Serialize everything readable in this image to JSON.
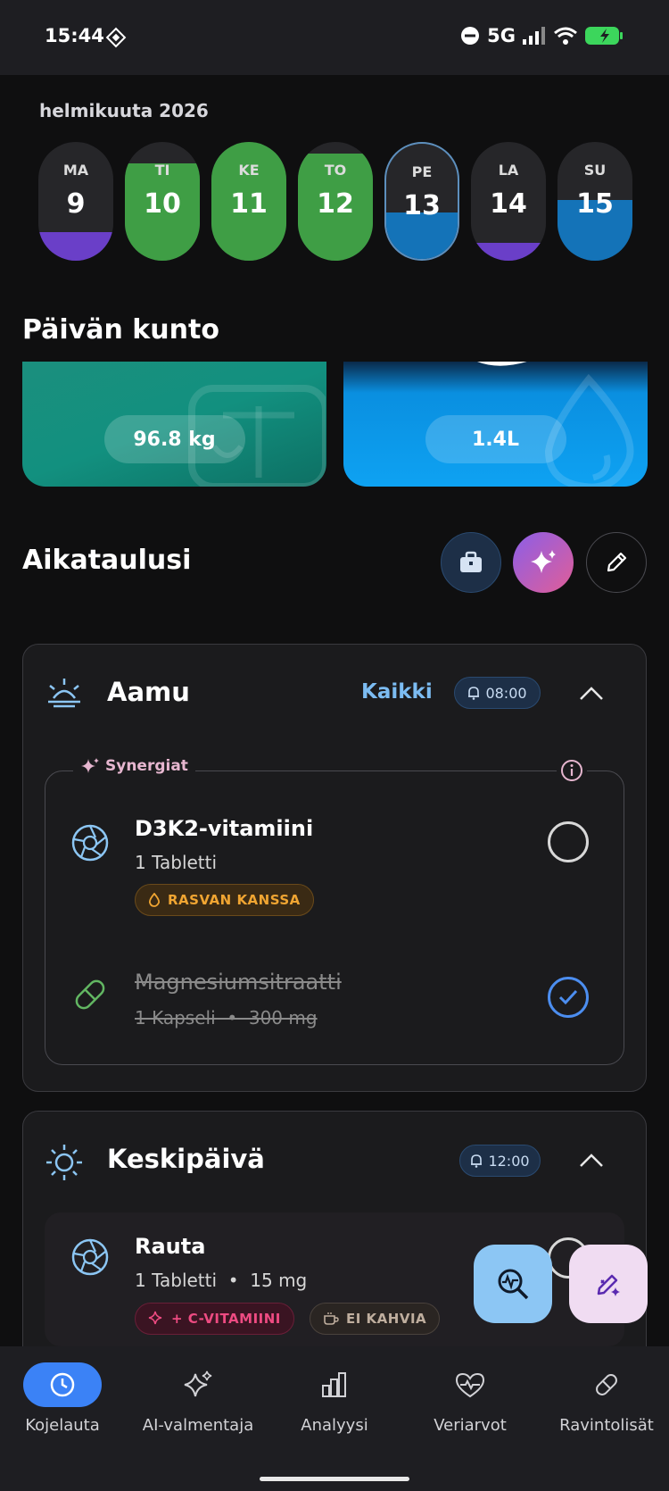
{
  "status": {
    "time": "15:44",
    "network": "5G"
  },
  "calendar": {
    "month": "helmikuuta 2026",
    "days": [
      {
        "name": "MA",
        "num": "9"
      },
      {
        "name": "TI",
        "num": "10"
      },
      {
        "name": "KE",
        "num": "11"
      },
      {
        "name": "TO",
        "num": "12"
      },
      {
        "name": "PE",
        "num": "13"
      },
      {
        "name": "LA",
        "num": "14"
      },
      {
        "name": "SU",
        "num": "15"
      }
    ]
  },
  "condition": {
    "title": "Päivän kunto",
    "weight": "96.8 kg",
    "water": "1.4L"
  },
  "schedule": {
    "title": "Aikataulusi",
    "morning": {
      "title": "Aamu",
      "all_link": "Kaikki",
      "time": "08:00",
      "synergy_label": "Synergiat",
      "items": [
        {
          "name": "D3K2-vitamiini",
          "sub": "1 Tabletti",
          "tag": "RASVAN KANSSA"
        },
        {
          "name": "Magnesiumsitraatti",
          "sub": "1 Kapseli  •  300 mg"
        }
      ]
    },
    "noon": {
      "title": "Keskipäivä",
      "time": "12:00",
      "items": [
        {
          "name": "Rauta",
          "sub": "1 Tabletti  •  15 mg",
          "tags": [
            "+ C-VITAMIINI",
            "EI KAHVIA"
          ]
        }
      ]
    }
  },
  "nav": {
    "items": [
      "Kojelauta",
      "AI-valmentaja",
      "Analyysi",
      "Veriarvot",
      "Ravintolisät"
    ]
  }
}
